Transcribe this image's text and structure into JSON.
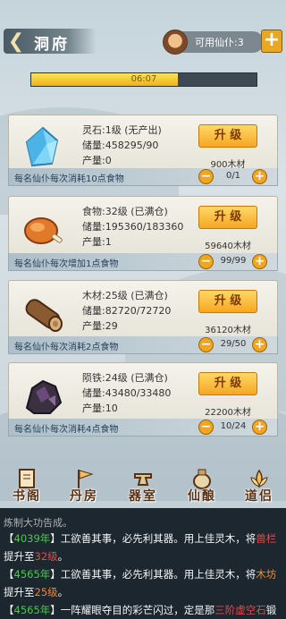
{
  "header": {
    "back_icon": "chevron-left-icon",
    "title": "洞府",
    "servant_label": "可用仙仆:3",
    "add_label": "+"
  },
  "progress": {
    "text": "06:07",
    "fraction": 0.65
  },
  "cards": [
    {
      "icon": "spirit-stone-icon",
      "line1": "灵石:1级 (无产出)",
      "line2": "储量:458295/90",
      "line3": "产量:0",
      "button": "升 级",
      "cost": "900木材",
      "hint": "每名仙仆每次消耗10点食物",
      "minus": "−",
      "count": "0/1",
      "plus": "+"
    },
    {
      "icon": "roast-meat-icon",
      "line1": "食物:32级 (已满仓)",
      "line2": "储量:195360/183360",
      "line3": "产量:1",
      "button": "升 级",
      "cost": "59640木材",
      "hint": "每名仙仆每次增加1点食物",
      "minus": "−",
      "count": "99/99",
      "plus": "+"
    },
    {
      "icon": "wood-log-icon",
      "line1": "木材:25级 (已满仓)",
      "line2": "储量:82720/72720",
      "line3": "产量:29",
      "button": "升 级",
      "cost": "36120木材",
      "hint": "每名仙仆每次消耗2点食物",
      "minus": "−",
      "count": "29/50",
      "plus": "+"
    },
    {
      "icon": "meteorite-ore-icon",
      "line1": "陨铁:24级 (已满仓)",
      "line2": "储量:43480/33480",
      "line3": "产量:10",
      "button": "升 级",
      "cost": "22200木材",
      "hint": "每名仙仆每次消耗4点食物",
      "minus": "−",
      "count": "10/24",
      "plus": "+"
    }
  ],
  "nav": [
    {
      "label": "书阁",
      "icon": "scroll-icon"
    },
    {
      "label": "丹房",
      "icon": "flag-icon"
    },
    {
      "label": "器室",
      "icon": "anvil-icon"
    },
    {
      "label": "仙酿",
      "icon": "wine-jar-icon"
    },
    {
      "label": "道侣",
      "icon": "lotus-icon"
    }
  ],
  "log": {
    "cut_line": "炼制大功告成。",
    "entries": [
      {
        "year": "4039年",
        "text_before": "】工欲善其事，必先利其器。用上佳灵木，将",
        "highlight": "兽栏",
        "text_after": "提升至",
        "level": "32级",
        "end": "。"
      },
      {
        "year": "4565年",
        "text_before": "】工欲善其事，必先利其器。用上佳灵木，将",
        "highlight": "木坊",
        "text_after": "提升至",
        "level": "25级",
        "end": "。"
      },
      {
        "year": "4565年",
        "text_before": "】一阵耀眼夺目的彩芒闪过，定是那",
        "highlight": "三阶虚空石",
        "text_after": "锻造大功告成。",
        "level": "",
        "end": ""
      }
    ]
  },
  "colors": {
    "accent_orange": "#f0a61e",
    "year_green": "#49c94c",
    "highlight_red": "#e04d4d",
    "highlight_orange": "#f08a1e"
  }
}
